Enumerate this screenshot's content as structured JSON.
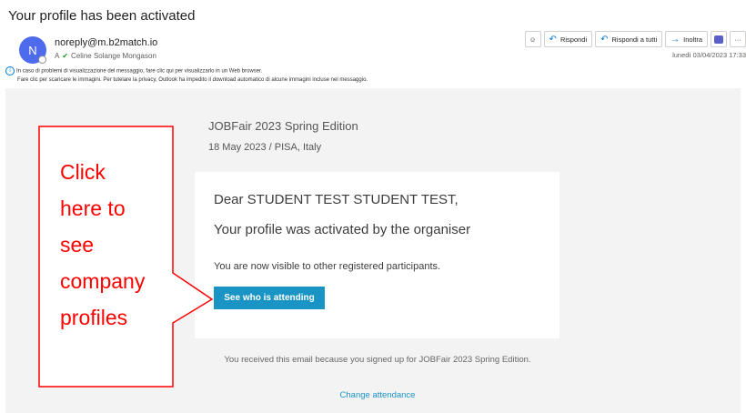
{
  "email": {
    "subject": "Your profile has been activated",
    "avatar_initial": "N",
    "sender": "noreply@m.b2match.io",
    "to_prefix": "A",
    "recipient": "Celine Solange Mongason",
    "info_line1": "In caso di problemi di visualizzazione del messaggio, fare clic qui per visualizzarlo in un Web browser.",
    "info_line2": "Fare clic per scaricare le immagini. Per tutelare la privacy, Outlook ha impedito il download automatico di alcune immagini incluse nel messaggio.",
    "date": "lunedì 03/04/2023 17:33"
  },
  "toolbar": {
    "reply": "Rispondi",
    "reply_all": "Rispondi a tutti",
    "forward": "Inoltra",
    "more": "···"
  },
  "body": {
    "event_title": "JOBFair 2023 Spring Edition",
    "event_date": "18 May 2023 / PISA, Italy",
    "greeting": "Dear STUDENT TEST STUDENT TEST,",
    "activated": "Your profile was activated by the organiser",
    "visible": "You are now visible to other registered participants.",
    "cta": "See who is attending",
    "footer": "You received this email because you signed up for JOBFair 2023 Spring Edition.",
    "change": "Change attendance"
  },
  "callout": {
    "lines": [
      "Click",
      "here to",
      "see",
      "company",
      "profiles"
    ],
    "color": "#ff0000"
  },
  "colors": {
    "accent": "#1a94c4",
    "outlook_blue": "#0078d4",
    "avatar": "#4f6bed"
  }
}
